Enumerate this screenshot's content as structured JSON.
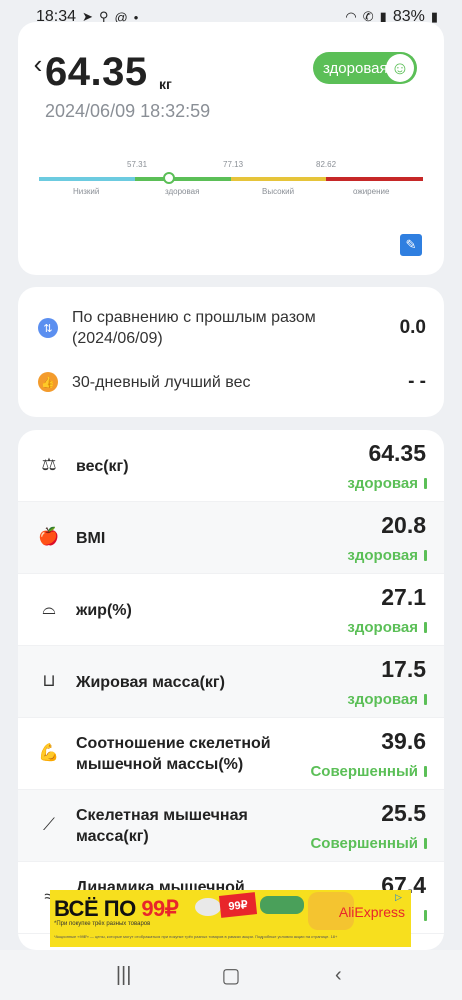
{
  "status_bar": {
    "time": "18:34",
    "left_icons": [
      "telegram-icon",
      "search-icon",
      "at-icon",
      "dot-icon"
    ],
    "battery": "83%"
  },
  "header": {
    "weight": "64.35",
    "unit": "кг",
    "timestamp": "2024/06/09 18:32:59",
    "status_badge": "здоровая"
  },
  "scale": {
    "thresholds": [
      "57.31",
      "77.13",
      "82.62"
    ],
    "segments": [
      {
        "label": "Низкий",
        "color": "#6ccbe0"
      },
      {
        "label": "здоровая",
        "color": "#5bbf57"
      },
      {
        "label": "Высокий",
        "color": "#e6c43a"
      },
      {
        "label": "ожирение",
        "color": "#c62828"
      }
    ]
  },
  "comparison": {
    "previous_label": "По сравнению с прошлым разом (2024/06/09)",
    "previous_value": "0.0",
    "best_label": "30-дневный лучший вес",
    "best_value": "- -"
  },
  "metrics": [
    {
      "icon": "scale-icon",
      "label": "вес(кг)",
      "value": "64.35",
      "status": "здоровая"
    },
    {
      "icon": "apple-icon",
      "label": "BMI",
      "value": "20.8",
      "status": "здоровая"
    },
    {
      "icon": "waist-icon",
      "label": "жир(%)",
      "value": "27.1",
      "status": "здоровая"
    },
    {
      "icon": "body-fat-icon",
      "label": "Жировая масса(кг)",
      "value": "17.5",
      "status": "здоровая"
    },
    {
      "icon": "muscle-arm-icon",
      "label": "Соотношение скелетной мышечной массы(%)",
      "value": "39.6",
      "status": "Совершенный"
    },
    {
      "icon": "muscle-leg-icon",
      "label": "Скелетная мышечная масса(кг)",
      "value": "25.5",
      "status": "Совершенный"
    },
    {
      "icon": "muscle-icon",
      "label": "Динамика мышечной",
      "value": "67.4",
      "status": ""
    }
  ],
  "ad": {
    "headline_prefix": "ВСЁ ПО ",
    "headline_price": "99₽",
    "subline": "*При покупке трёх разных товаров",
    "price_tag": "99₽",
    "brand": "AliExpress",
    "fine_print": "*Акционные «99₽» — цены, которые могут отображаться при покупке трёх разных товаров в рамках акции. Подробные условия акции на странице. 18+"
  },
  "colors": {
    "accent_green": "#5bbf57",
    "edit_blue": "#2f7fe0"
  }
}
